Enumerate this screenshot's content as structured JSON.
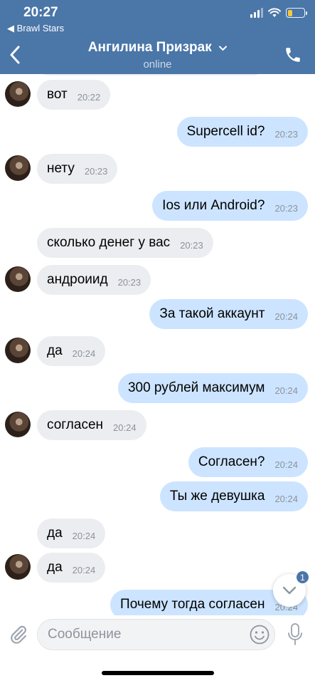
{
  "status_bar": {
    "time": "20:27",
    "back_app": "◀ Brawl Stars",
    "battery_color": "#f7c742"
  },
  "nav": {
    "title": "Ангилина Призрак",
    "subtitle": "online",
    "back_icon": "chevron-left-icon",
    "call_icon": "phone-icon",
    "accent": "#4a76a8"
  },
  "messages": [
    {
      "dir": "in",
      "avatar": true,
      "text": "вот",
      "time": "20:22"
    },
    {
      "dir": "out",
      "avatar": false,
      "text": "Supercell id?",
      "time": "20:23"
    },
    {
      "dir": "in",
      "avatar": true,
      "text": "нету",
      "time": "20:23"
    },
    {
      "dir": "out",
      "avatar": false,
      "text": "Ios или Android?",
      "time": "20:23"
    },
    {
      "dir": "in",
      "avatar": false,
      "text": "сколько денег у вас",
      "time": "20:23"
    },
    {
      "dir": "in",
      "avatar": true,
      "text": "андроиид",
      "time": "20:23"
    },
    {
      "dir": "out",
      "avatar": false,
      "text": "За такой аккаунт",
      "time": "20:24"
    },
    {
      "dir": "in",
      "avatar": true,
      "text": "да",
      "time": "20:24"
    },
    {
      "dir": "out",
      "avatar": false,
      "text": "300 рублей максимум",
      "time": "20:24"
    },
    {
      "dir": "in",
      "avatar": true,
      "text": "согласен",
      "time": "20:24"
    },
    {
      "dir": "out",
      "avatar": false,
      "text": "Согласен?",
      "time": "20:24"
    },
    {
      "dir": "out",
      "avatar": false,
      "text": "Ты же девушка",
      "time": "20:24"
    },
    {
      "dir": "in",
      "avatar": false,
      "text": "да",
      "time": "20:24"
    },
    {
      "dir": "in",
      "avatar": true,
      "text": "да",
      "time": "20:24"
    },
    {
      "dir": "out",
      "avatar": false,
      "text": "Почему тогда согласен",
      "time": "20:24"
    }
  ],
  "scroll_button": {
    "badge": "1",
    "icon": "chevron-down-icon"
  },
  "composer": {
    "placeholder": "Сообщение",
    "attach_icon": "paperclip-icon",
    "emoji_icon": "smiley-icon",
    "mic_icon": "microphone-icon"
  },
  "colors": {
    "incoming_bubble": "#ebedf0",
    "outgoing_bubble": "#cce4ff",
    "timestamp": "#8c939c"
  }
}
